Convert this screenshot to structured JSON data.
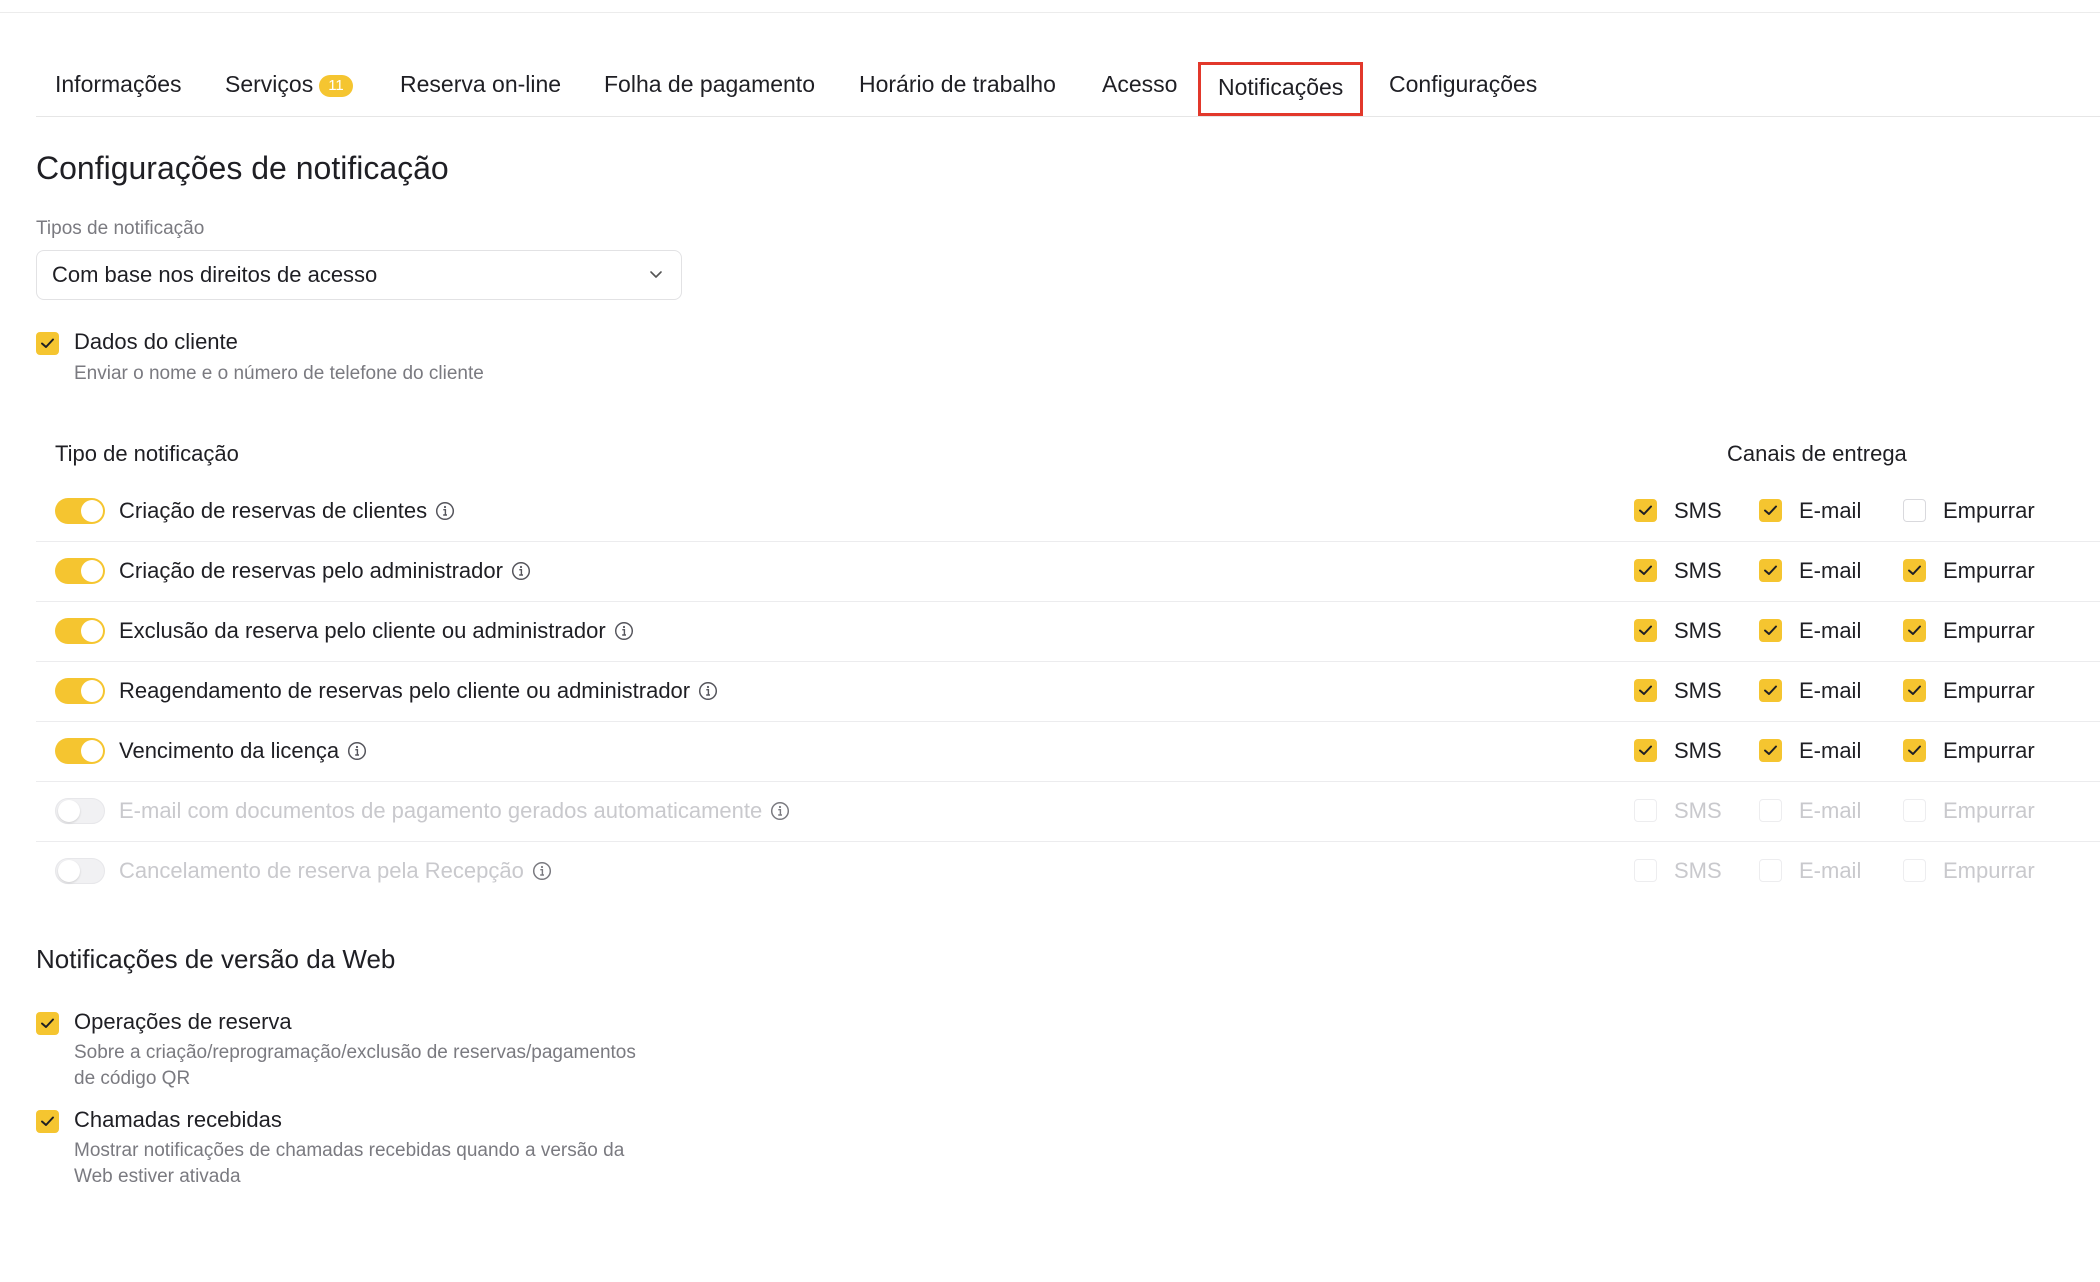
{
  "tabs": [
    {
      "label": "Informações"
    },
    {
      "label": "Serviços",
      "badge": "11"
    },
    {
      "label": "Reserva on-line"
    },
    {
      "label": "Folha de pagamento"
    },
    {
      "label": "Horário de trabalho"
    },
    {
      "label": "Acesso"
    },
    {
      "label": "Notificações",
      "active": true
    },
    {
      "label": "Configurações"
    }
  ],
  "settings": {
    "title": "Configurações de notificação",
    "types_label": "Tipos de notificação",
    "types_value": "Com base nos direitos de acesso",
    "client_data": {
      "checked": true,
      "label": "Dados do cliente",
      "desc": "Enviar o nome e o número de telefone do cliente"
    }
  },
  "table": {
    "col_type": "Tipo de notificação",
    "col_channels": "Canais de entrega",
    "channel_labels": {
      "sms": "SMS",
      "email": "E-mail",
      "push": "Empurrar"
    },
    "rows": [
      {
        "label": "Criação de reservas de clientes",
        "enabled": true,
        "sms": true,
        "email": true,
        "push": false
      },
      {
        "label": "Criação de reservas pelo administrador",
        "enabled": true,
        "sms": true,
        "email": true,
        "push": true
      },
      {
        "label": "Exclusão da reserva pelo cliente ou administrador",
        "enabled": true,
        "sms": true,
        "email": true,
        "push": true
      },
      {
        "label": "Reagendamento de reservas pelo cliente ou administrador",
        "enabled": true,
        "sms": true,
        "email": true,
        "push": true
      },
      {
        "label": "Vencimento da licença",
        "enabled": true,
        "sms": true,
        "email": true,
        "push": true
      },
      {
        "label": "E-mail com documentos de pagamento gerados automaticamente",
        "enabled": false,
        "sms": false,
        "email": false,
        "push": false
      },
      {
        "label": "Cancelamento de reserva pela Recepção",
        "enabled": false,
        "sms": false,
        "email": false,
        "push": false
      }
    ]
  },
  "web": {
    "title": "Notificações de versão da Web",
    "items": [
      {
        "checked": true,
        "label": "Operações de reserva",
        "desc_line1": "Sobre a criação/reprogramação/exclusão de reservas/pagamentos",
        "desc_line2": "de código QR"
      },
      {
        "checked": true,
        "label": "Chamadas recebidas",
        "desc_line1": "Mostrar notificações de chamadas recebidas quando a versão da",
        "desc_line2": "Web estiver ativada"
      }
    ]
  },
  "colors": {
    "accent": "#f5c530",
    "active_tab_outline": "#e2382b"
  }
}
